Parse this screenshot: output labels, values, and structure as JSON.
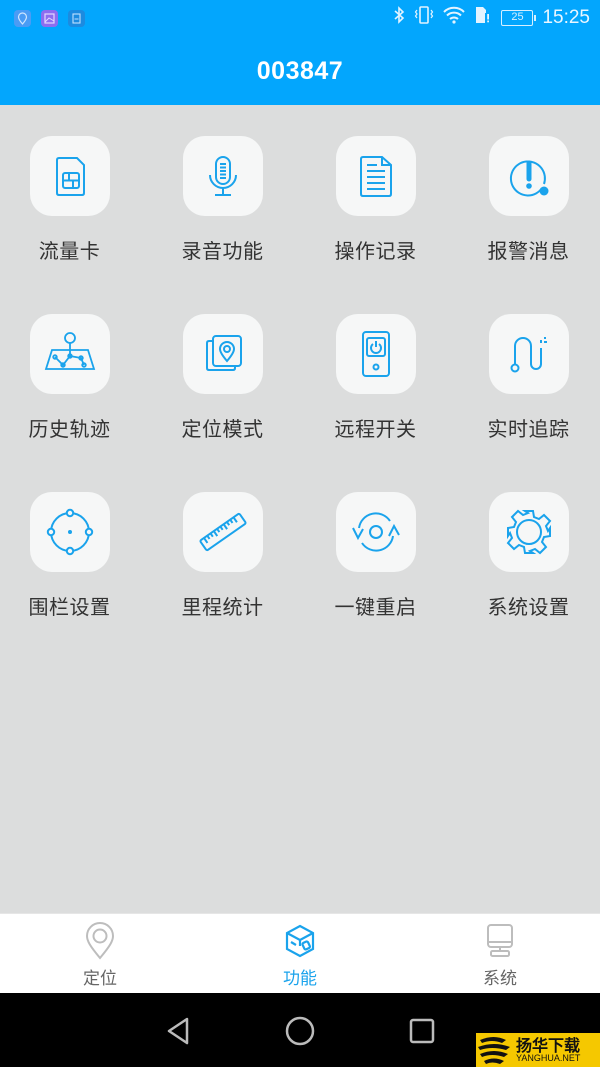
{
  "status_bar": {
    "time": "15:25",
    "battery": "25",
    "left_icons": [
      "location-app-icon",
      "gallery-app-icon",
      "sim-app-icon"
    ],
    "right_icons": [
      "bluetooth-icon",
      "vibrate-icon",
      "wifi-icon",
      "sim-alert-icon",
      "battery-icon"
    ]
  },
  "header": {
    "title": "003847"
  },
  "functions": [
    {
      "label": "流量卡",
      "icon": "sim-card-icon"
    },
    {
      "label": "录音功能",
      "icon": "microphone-icon"
    },
    {
      "label": "操作记录",
      "icon": "document-icon"
    },
    {
      "label": "报警消息",
      "icon": "alert-icon"
    },
    {
      "label": "历史轨迹",
      "icon": "map-track-icon"
    },
    {
      "label": "定位模式",
      "icon": "location-layers-icon"
    },
    {
      "label": "远程开关",
      "icon": "remote-power-icon"
    },
    {
      "label": "实时追踪",
      "icon": "realtime-path-icon"
    },
    {
      "label": "围栏设置",
      "icon": "geofence-icon"
    },
    {
      "label": "里程统计",
      "icon": "ruler-icon"
    },
    {
      "label": "一键重启",
      "icon": "restart-icon"
    },
    {
      "label": "系统设置",
      "icon": "gear-icon"
    }
  ],
  "tabs": [
    {
      "label": "定位",
      "icon": "location-pin-icon",
      "active": false
    },
    {
      "label": "功能",
      "icon": "cube-icon",
      "active": true
    },
    {
      "label": "系统",
      "icon": "monitor-icon",
      "active": false
    }
  ],
  "colors": {
    "primary": "#03a6fd",
    "icon_blue": "#1aa3ec",
    "background": "#dcdddd",
    "tab_inactive": "#666666"
  },
  "watermark": {
    "cn": "扬华下载",
    "en": "YANGHUA.NET"
  }
}
